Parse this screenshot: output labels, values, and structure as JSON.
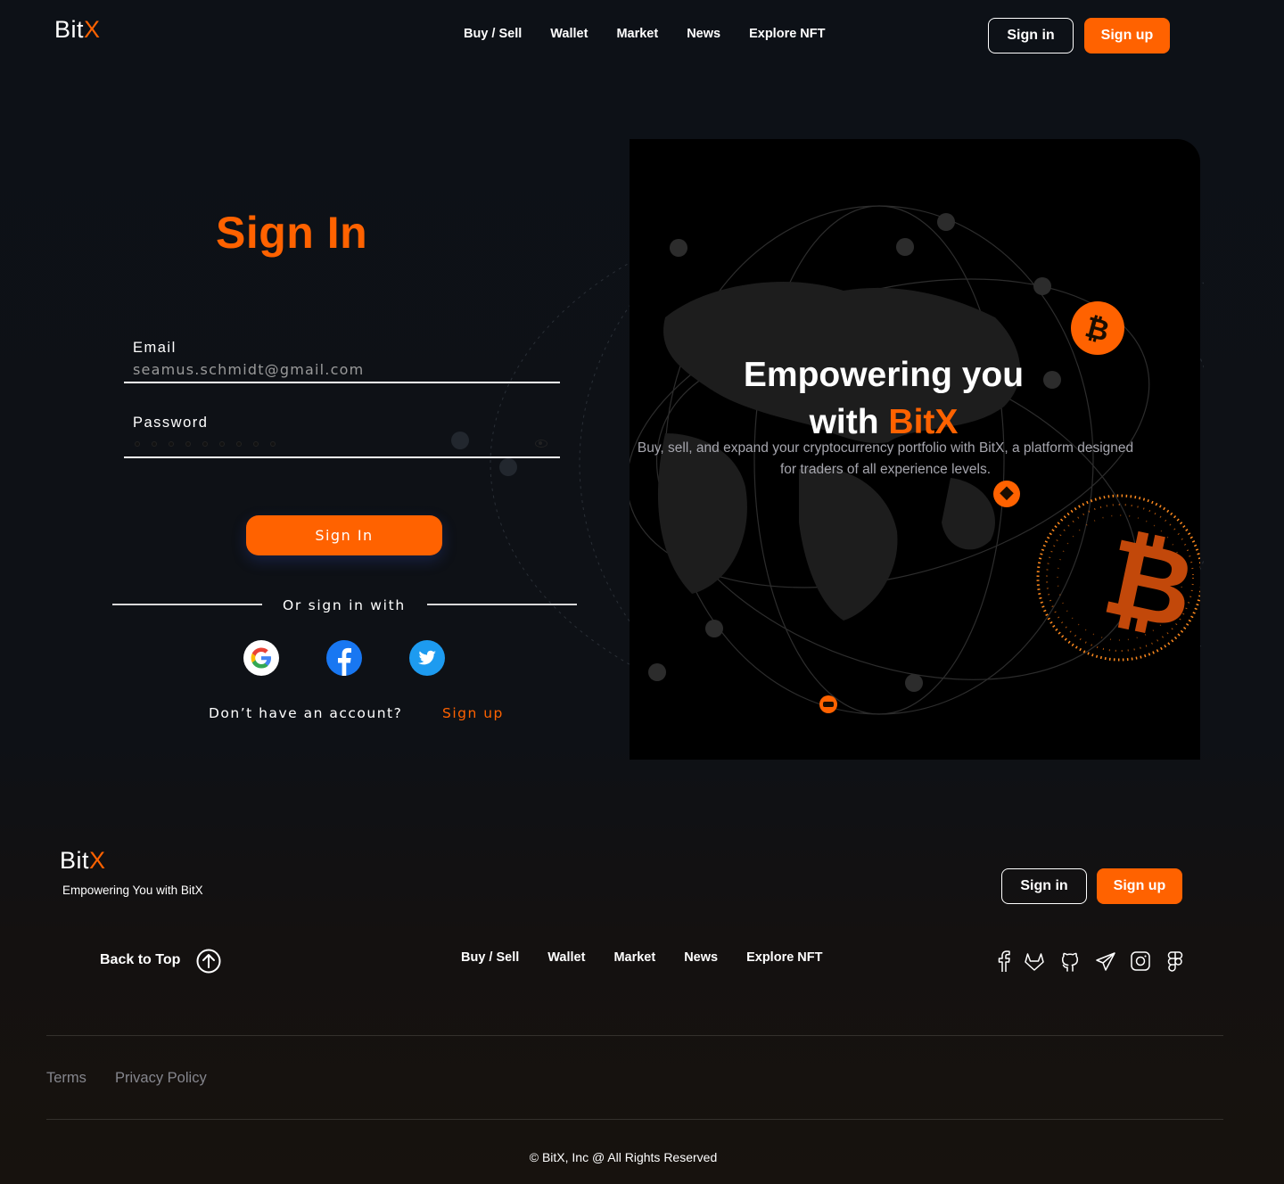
{
  "brand": {
    "name": "Bit",
    "accent": "X",
    "accent_color": "#ff6200"
  },
  "header": {
    "nav": [
      "Buy / Sell",
      "Wallet",
      "Market",
      "News",
      "Explore NFT"
    ],
    "signin_label": "Sign in",
    "signup_label": "Sign up"
  },
  "form": {
    "title": "Sign In",
    "email_label": "Email",
    "email_value": "seamus.schmidt@gmail.com",
    "password_label": "Password",
    "password_length": 9,
    "submit_label": "Sign In",
    "or_text": "Or sign in with",
    "social": [
      "google-icon",
      "facebook-icon",
      "twitter-icon"
    ],
    "no_account": "Don’t have an account?",
    "signup_link": "Sign up"
  },
  "promo": {
    "heading_line1": "Empowering you",
    "heading_with": "with",
    "heading_brand": "BitX",
    "subtitle": "Buy, sell, and expand your cryptocurrency portfolio with BitX, a platform designed for traders of all experience levels."
  },
  "footer": {
    "tagline": "Empowering You with BitX",
    "signin_label": "Sign in",
    "signup_label": "Sign up",
    "back_to_top": "Back to Top",
    "nav": [
      "Buy / Sell",
      "Wallet",
      "Market",
      "News",
      "Explore NFT"
    ],
    "social": [
      "facebook-icon",
      "gitlab-icon",
      "github-icon",
      "telegram-icon",
      "instagram-icon",
      "figma-icon"
    ],
    "terms": "Terms",
    "privacy": "Privacy Policy",
    "copyright": "© BitX, Inc @ All Rights Reserved"
  }
}
